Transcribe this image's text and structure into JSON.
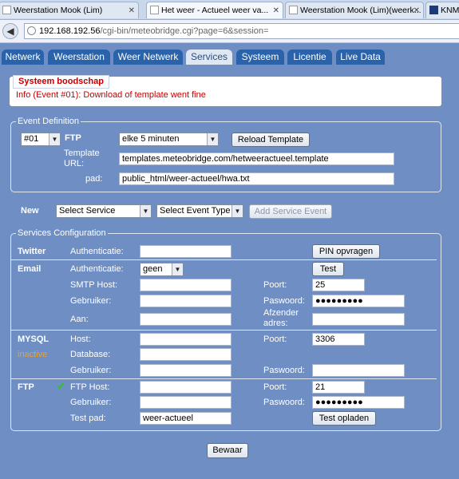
{
  "browser": {
    "tabs": [
      {
        "label": "Weerstation Mook (Lim)"
      },
      {
        "label": "Het weer - Actueel weer va..."
      },
      {
        "label": "Weerstation Mook (Lim)(weerk..."
      },
      {
        "label": "KNM"
      }
    ],
    "url": {
      "host": "192.168.192.56",
      "path": "/cgi-bin/meteobridge.cgi?page=6&session="
    }
  },
  "nav_tabs": [
    "Netwerk",
    "Weerstation",
    "Weer Netwerk",
    "Services",
    "Systeem",
    "Licentie",
    "Live Data"
  ],
  "active_tab": "Services",
  "system_message": {
    "title": "Systeem boodschap",
    "text": "Info (Event #01): Download of template went fine"
  },
  "event_definition": {
    "legend": "Event Definition",
    "event_number": "#01",
    "type_label": "FTP",
    "interval": "elke 5 minuten",
    "reload_button": "Reload Template",
    "template_url_label": "Template URL:",
    "template_url": "templates.meteobridge.com/hetweeractueel.template",
    "path_label": "pad:",
    "path": "public_html/weer-actueel/hwa.txt"
  },
  "new_event": {
    "label": "New",
    "service_select": "Select Service",
    "event_type_select": "Select Event Type",
    "add_button": "Add Service Event"
  },
  "services_config": {
    "legend": "Services Configuration",
    "twitter": {
      "title": "Twitter",
      "auth_label": "Authenticatie:",
      "pin_button": "PIN opvragen"
    },
    "email": {
      "title": "Email",
      "auth_label": "Authenticatie:",
      "auth_value": "geen",
      "test_button": "Test",
      "smtp_label": "SMTP Host:",
      "port_label": "Poort:",
      "port_value": "25",
      "user_label": "Gebruiker:",
      "password_label": "Paswoord:",
      "password_value": "●●●●●●●●●",
      "to_label": "Aan:",
      "sender_label": "Afzender adres:"
    },
    "mysql": {
      "title": "MYSQL",
      "status": "inactive",
      "host_label": "Host:",
      "port_label": "Poort:",
      "port_value": "3306",
      "database_label": "Database:",
      "user_label": "Gebruiker:",
      "password_label": "Paswoord:"
    },
    "ftp": {
      "title": "FTP",
      "host_label": "FTP Host:",
      "port_label": "Poort:",
      "port_value": "21",
      "user_label": "Gebruiker:",
      "password_label": "Paswoord:",
      "password_value": "●●●●●●●●●",
      "test_path_label": "Test pad:",
      "test_path_value": "weer-actueel",
      "test_upload_button": "Test opladen"
    }
  },
  "save_button": "Bewaar",
  "colors": {
    "page_background": "#6f8fc4",
    "tab_background": "#2a63a9",
    "message_red": "#c00000",
    "inactive_orange": "#f0a020",
    "check_green": "#3db83d"
  }
}
